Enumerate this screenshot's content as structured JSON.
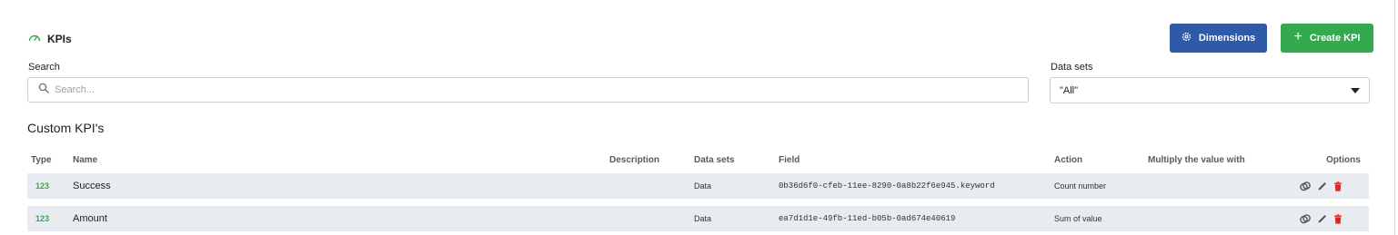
{
  "header": {
    "title": "KPIs",
    "icon": "gauge-icon"
  },
  "toolbar": {
    "dimensions_label": "Dimensions",
    "create_label": "Create KPI"
  },
  "search": {
    "label": "Search",
    "placeholder": "Search...",
    "value": ""
  },
  "datasets_filter": {
    "label": "Data sets",
    "selected": "\"All\""
  },
  "section": {
    "title": "Custom KPI's"
  },
  "table": {
    "columns": {
      "type": "Type",
      "name": "Name",
      "description": "Description",
      "datasets": "Data sets",
      "field": "Field",
      "action": "Action",
      "multiply": "Multiply the value with",
      "options": "Options"
    },
    "rows": [
      {
        "type": "123",
        "name": "Success",
        "description": "",
        "datasets": "Data",
        "field": "0b36d6f0-cfeb-11ee-8290-0a8b22f6e945.keyword",
        "action": "Count number",
        "multiply": ""
      },
      {
        "type": "123",
        "name": "Amount",
        "description": "",
        "datasets": "Data",
        "field": "ea7d1d1e-49fb-11ed-b05b-0ad674e40619",
        "action": "Sum of value",
        "multiply": ""
      }
    ]
  },
  "colors": {
    "primary": "#2f5aa8",
    "success": "#35a94d",
    "danger": "#e02424",
    "row_bg": "#e8ebf0"
  }
}
